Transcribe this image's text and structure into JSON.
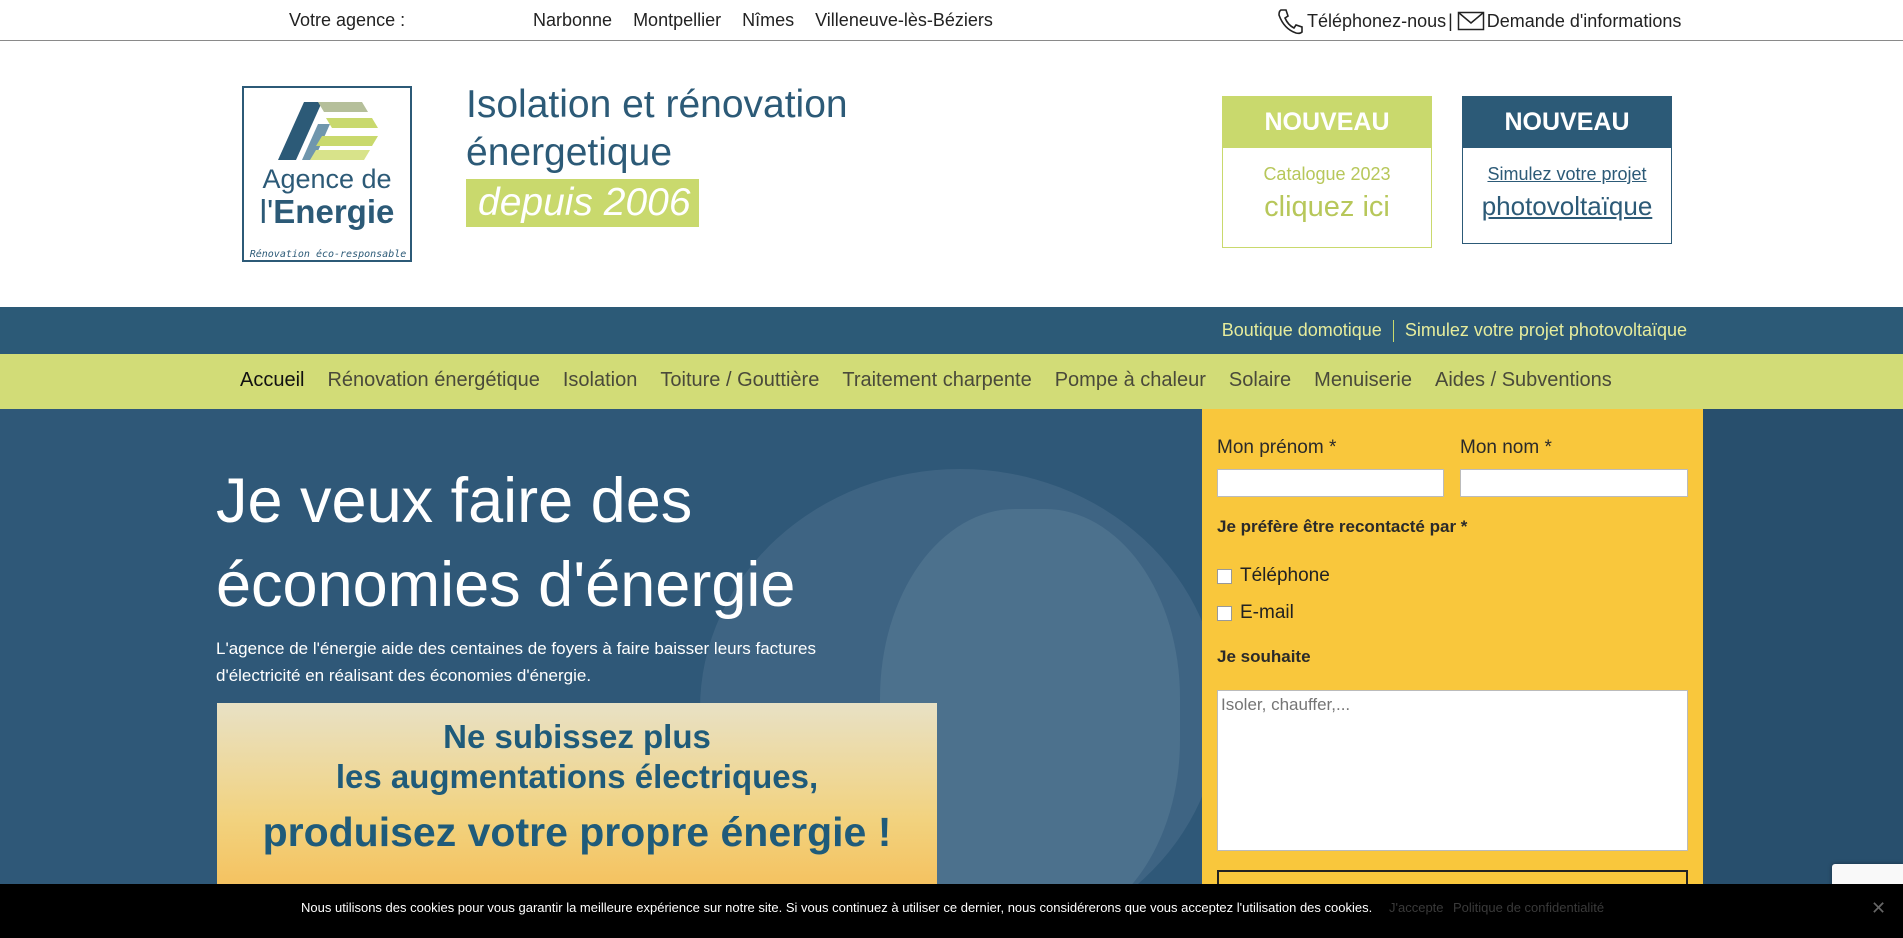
{
  "topbar": {
    "agence_label": "Votre agence :",
    "cities": [
      "Narbonne",
      "Montpellier",
      "Nîmes",
      "Villeneuve-lès-Béziers"
    ],
    "phone_label": "Téléphonez-nous",
    "separator": "|",
    "info_label": "Demande d'informations"
  },
  "logo": {
    "line1": "Agence de",
    "line2_prefix": "l'",
    "line2_bold": "Energie",
    "tagline": "Rénovation éco-responsable"
  },
  "headline": {
    "line1": "Isolation et rénovation",
    "line2": "énergetique",
    "highlight": "depuis 2006"
  },
  "cards": [
    {
      "badge": "NOUVEAU",
      "sub": "Catalogue 2023",
      "cta": "cliquez ici"
    },
    {
      "badge": "NOUVEAU",
      "sub": "Simulez votre projet",
      "cta": "photovoltaïque"
    }
  ],
  "subnav": [
    "Boutique domotique",
    "Simulez votre projet photovoltaïque"
  ],
  "mainnav": [
    "Accueil",
    "Rénovation énergétique",
    "Isolation",
    "Toiture / Gouttière",
    "Traitement charpente",
    "Pompe à chaleur",
    "Solaire",
    "Menuiserie",
    "Aides / Subventions"
  ],
  "hero": {
    "title": "Je veux faire des économies d'énergie",
    "text": "L'agence de l'énergie aide des centaines de foyers à faire baisser leurs factures d'électricité en réalisant des économies d'énergie."
  },
  "promo": {
    "line1": "Ne subissez plus",
    "line2": "les augmentations électriques,",
    "line3": "produisez votre propre énergie !"
  },
  "form": {
    "firstname_label": "Mon prénom *",
    "lastname_label": "Mon nom *",
    "contact_pref_label": "Je préfère être recontacté par *",
    "option_phone": "Téléphone",
    "option_email": "E-mail",
    "wish_label": "Je souhaite",
    "wish_placeholder": "Isoler, chauffer,..."
  },
  "cookie": {
    "message": "Nous utilisons des cookies pour vous garantir la meilleure expérience sur notre site. Si vous continuez à utiliser ce dernier, nous considérerons que vous acceptez l'utilisation des cookies.",
    "accept": "J'accepte",
    "policy": "Politique de confidentialité",
    "close": "✕"
  }
}
